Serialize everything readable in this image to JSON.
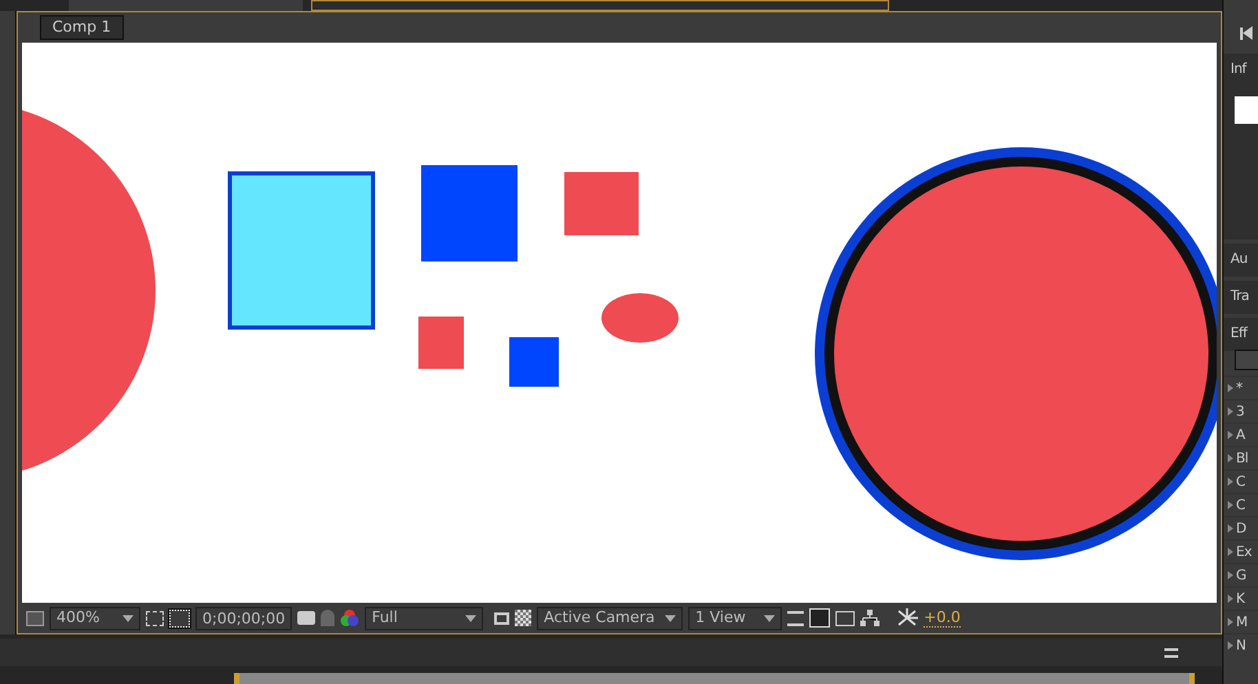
{
  "breadcrumb": "Comp 1",
  "viewer_toolbar": {
    "zoom": "400%",
    "timecode": "0;00;00;00",
    "resolution": "Full",
    "camera": "Active Camera",
    "views": "1 View",
    "exposure": "+0.0"
  },
  "right_panels": [
    {
      "title": "Inf"
    },
    {
      "title": "Au"
    },
    {
      "title": "Tra"
    },
    {
      "title": "Eff"
    }
  ],
  "effects": [
    {
      "label": "*"
    },
    {
      "label": "3"
    },
    {
      "label": "A"
    },
    {
      "label": "Bl"
    },
    {
      "label": "C"
    },
    {
      "label": "C"
    },
    {
      "label": "D"
    },
    {
      "label": "Ex"
    },
    {
      "label": "G"
    },
    {
      "label": "K"
    },
    {
      "label": "M"
    },
    {
      "label": "N"
    }
  ]
}
